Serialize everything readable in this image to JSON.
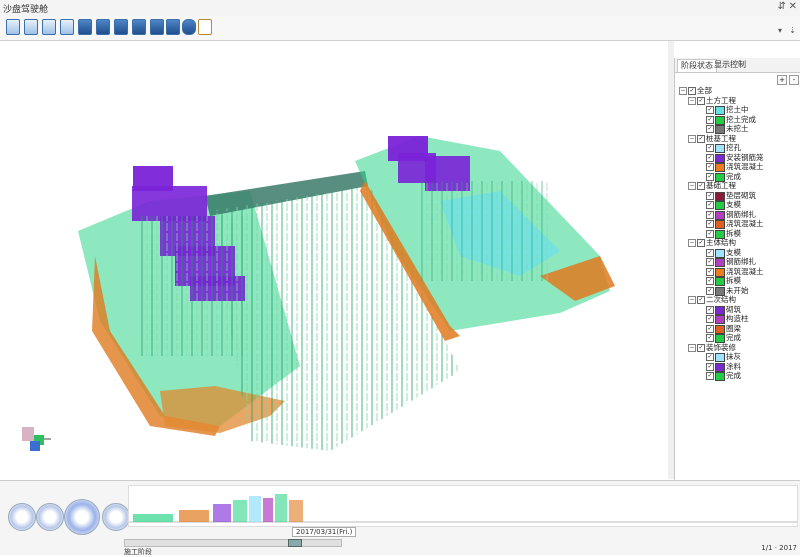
{
  "window": {
    "title": "沙盘驾驶舱",
    "pin_glyph": "⇵",
    "close_glyph": "✕"
  },
  "toolbar": {
    "buttons": [
      "view-front",
      "view-back",
      "view-left",
      "view-right",
      "view-top",
      "view-bottom",
      "view-iso-1",
      "view-iso-2",
      "view-iso-3",
      "view-iso-4",
      "layers",
      "document"
    ],
    "dropdown_glyph": "▾",
    "pin_glyph": "⇣"
  },
  "panel": {
    "tabs": [
      {
        "label": "阶段状态",
        "active": true
      },
      {
        "label": "显示控制",
        "active": false
      }
    ],
    "tools": [
      "+",
      "-"
    ],
    "tree": [
      {
        "level": 0,
        "expander": "−",
        "checked": true,
        "label": "全部"
      },
      {
        "level": 1,
        "expander": "−",
        "checked": true,
        "label": "土方工程"
      },
      {
        "level": 2,
        "checked": true,
        "color": "#66e0e0",
        "label": "挖土中"
      },
      {
        "level": 2,
        "checked": true,
        "color": "#22cc44",
        "label": "挖土完成"
      },
      {
        "level": 2,
        "checked": true,
        "color": "#777777",
        "label": "未挖土"
      },
      {
        "level": 1,
        "expander": "−",
        "checked": true,
        "label": "桩基工程"
      },
      {
        "level": 2,
        "checked": true,
        "color": "#9fe3ff",
        "label": "挖孔"
      },
      {
        "level": 2,
        "checked": true,
        "color": "#7a2bd0",
        "label": "安装钢筋笼"
      },
      {
        "level": 2,
        "checked": true,
        "color": "#ef7b1f",
        "label": "浇筑混凝土"
      },
      {
        "level": 2,
        "checked": true,
        "color": "#22cc44",
        "label": "完成"
      },
      {
        "level": 1,
        "expander": "−",
        "checked": true,
        "label": "基础工程"
      },
      {
        "level": 2,
        "checked": true,
        "color": "#8a1a3a",
        "label": "垫层砌筑"
      },
      {
        "level": 2,
        "checked": true,
        "color": "#22cc44",
        "label": "支模"
      },
      {
        "level": 2,
        "checked": true,
        "color": "#b040c0",
        "label": "钢筋绑扎"
      },
      {
        "level": 2,
        "checked": true,
        "color": "#e06020",
        "label": "浇筑混凝土"
      },
      {
        "level": 2,
        "checked": true,
        "color": "#22cc44",
        "label": "拆模"
      },
      {
        "level": 1,
        "expander": "−",
        "checked": true,
        "label": "主体结构"
      },
      {
        "level": 2,
        "checked": true,
        "color": "#9fe3ff",
        "label": "支模"
      },
      {
        "level": 2,
        "checked": true,
        "color": "#b040c0",
        "label": "钢筋绑扎"
      },
      {
        "level": 2,
        "checked": true,
        "color": "#ef7b1f",
        "label": "浇筑混凝土"
      },
      {
        "level": 2,
        "checked": true,
        "color": "#22cc44",
        "label": "拆模"
      },
      {
        "level": 2,
        "checked": true,
        "color": "#777777",
        "label": "未开始"
      },
      {
        "level": 1,
        "expander": "−",
        "checked": true,
        "label": "二次结构"
      },
      {
        "level": 2,
        "checked": true,
        "color": "#7a2bd0",
        "label": "砌筑"
      },
      {
        "level": 2,
        "checked": true,
        "color": "#b040c0",
        "label": "构造柱"
      },
      {
        "level": 2,
        "checked": true,
        "color": "#e06020",
        "label": "圈梁"
      },
      {
        "level": 2,
        "checked": true,
        "color": "#22cc44",
        "label": "完成"
      },
      {
        "level": 1,
        "expander": "−",
        "checked": true,
        "label": "装饰装修"
      },
      {
        "level": 2,
        "checked": true,
        "color": "#9fe3ff",
        "label": "抹灰"
      },
      {
        "level": 2,
        "checked": true,
        "color": "#7a2bd0",
        "label": "涂料"
      },
      {
        "level": 2,
        "checked": true,
        "color": "#22cc44",
        "label": "完成"
      }
    ]
  },
  "timeline": {
    "current_date": "2017/03/31(Fri.)",
    "status": "施工阶段",
    "right_info": "1/1 · 2017",
    "slider_fraction": 0.8
  }
}
